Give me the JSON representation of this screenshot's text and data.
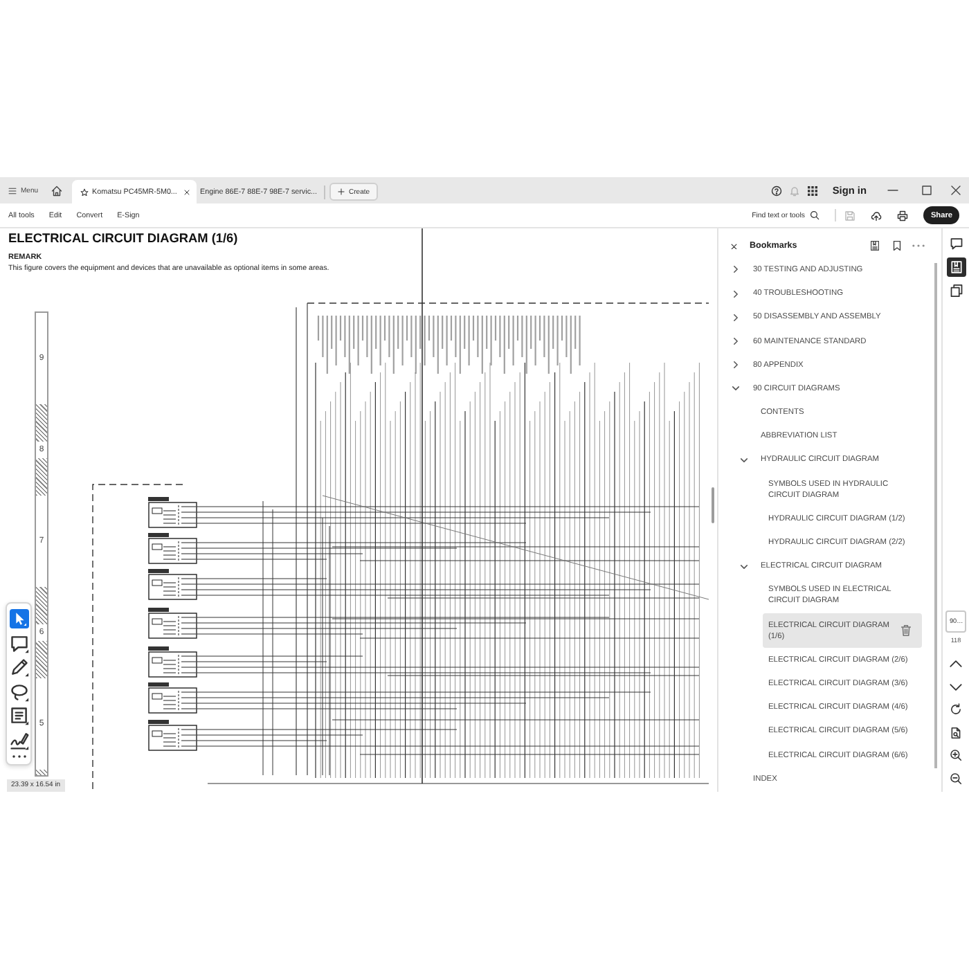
{
  "title_bar": {
    "menu_label": "Menu",
    "tabs": [
      {
        "title": "Komatsu PC45MR-5M0...",
        "selected": true
      },
      {
        "title": "Engine 86E-7 88E-7 98E-7 servic...",
        "selected": false
      }
    ],
    "create_label": "Create",
    "status_icons": [
      {
        "kind": "help",
        "disabled": false
      },
      {
        "kind": "notifications",
        "disabled": true
      },
      {
        "kind": "apps",
        "disabled": false
      }
    ],
    "sign_in": "Sign in"
  },
  "toolbar": {
    "menus": [
      "All tools",
      "Edit",
      "Convert",
      "E-Sign"
    ],
    "find_label": "Find text or tools",
    "actions": [
      {
        "kind": "save",
        "disabled": true
      },
      {
        "kind": "upload",
        "disabled": false
      },
      {
        "kind": "print",
        "disabled": false
      }
    ],
    "share_label": "Share"
  },
  "tool_palette": [
    {
      "kind": "select",
      "selected": true
    },
    {
      "kind": "comment",
      "selected": false
    },
    {
      "kind": "draw",
      "selected": false
    },
    {
      "kind": "lasso",
      "selected": false
    },
    {
      "kind": "text",
      "selected": false
    },
    {
      "kind": "sign",
      "selected": false
    }
  ],
  "document": {
    "title": "ELECTRICAL CIRCUIT DIAGRAM (1/6)",
    "remark_heading": "REMARK",
    "remark_text": "This figure covers the equipment and devices that are unavailable as optional items in some areas.",
    "ruler_labels": [
      "9",
      "8",
      "7",
      "6",
      "5"
    ],
    "page_size": "23.39 x 16.54 in"
  },
  "bookmarks": {
    "title": "Bookmarks",
    "items": [
      {
        "label": "30 TESTING AND ADJUSTING",
        "expanded": false,
        "selected": false
      },
      {
        "label": "40 TROUBLESHOOTING",
        "expanded": false,
        "selected": false
      },
      {
        "label": "50 DISASSEMBLY AND ASSEMBLY",
        "expanded": false,
        "selected": false
      },
      {
        "label": "60 MAINTENANCE STANDARD",
        "expanded": false,
        "selected": false
      },
      {
        "label": "80 APPENDIX",
        "expanded": false,
        "selected": false
      },
      {
        "label": "90 CIRCUIT DIAGRAMS",
        "expanded": true,
        "selected": false,
        "children": [
          {
            "label": "CONTENTS",
            "selected": false
          },
          {
            "label": "ABBREVIATION LIST",
            "selected": false
          },
          {
            "label": "HYDRAULIC CIRCUIT DIAGRAM",
            "expanded": true,
            "selected": false,
            "children": [
              {
                "label": "SYMBOLS USED IN HYDRAULIC CIRCUIT DIAGRAM",
                "selected": false
              },
              {
                "label": "HYDRAULIC CIRCUIT DIAGRAM (1/2)",
                "selected": false
              },
              {
                "label": "HYDRAULIC CIRCUIT DIAGRAM (2/2)",
                "selected": false
              }
            ]
          },
          {
            "label": "ELECTRICAL CIRCUIT DIAGRAM",
            "expanded": true,
            "selected": false,
            "children": [
              {
                "label": "SYMBOLS USED IN ELECTRICAL CIRCUIT DIAGRAM",
                "selected": false
              },
              {
                "label": "ELECTRICAL CIRCUIT DIAGRAM (1/6)",
                "selected": true
              },
              {
                "label": "ELECTRICAL CIRCUIT DIAGRAM (2/6)",
                "selected": false
              },
              {
                "label": "ELECTRICAL CIRCUIT DIAGRAM (3/6)",
                "selected": false
              },
              {
                "label": "ELECTRICAL CIRCUIT DIAGRAM (4/6)",
                "selected": false
              },
              {
                "label": "ELECTRICAL CIRCUIT DIAGRAM (5/6)",
                "selected": false
              },
              {
                "label": "ELECTRICAL CIRCUIT DIAGRAM (6/6)",
                "selected": false
              }
            ]
          }
        ]
      },
      {
        "label": "INDEX",
        "selected": false
      }
    ]
  },
  "right_rail": {
    "panels": [
      {
        "kind": "comments",
        "selected": false
      },
      {
        "kind": "bookmarks",
        "selected": true
      },
      {
        "kind": "pages",
        "selected": false
      }
    ],
    "page_number": "90…",
    "page_count": "118"
  }
}
